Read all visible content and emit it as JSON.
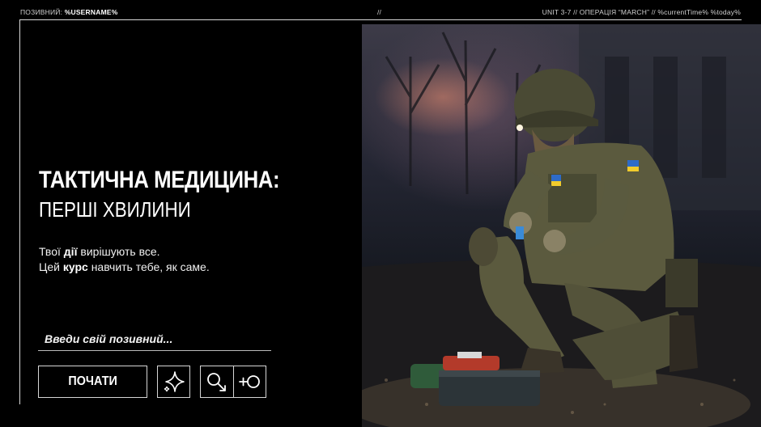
{
  "topbar": {
    "callsign_label": "ПОЗИВНИЙ:",
    "callsign_value": "%USERNAME%",
    "separator": "//",
    "status": "UNIT 3-7 // ОПЕРАЦІЯ “MARCH” // %currentTime% %today%"
  },
  "main": {
    "title_line1": "ТАКТИЧНА МЕДИЦИНА:",
    "title_line2": "ПЕРШІ ХВИЛИНИ",
    "desc_line1_a": "Твої ",
    "desc_line1_b": "дії",
    "desc_line1_c": " вирішують все.",
    "desc_line2_a": "Цей ",
    "desc_line2_b": "курс",
    "desc_line2_c": " навчить тебе, як саме."
  },
  "form": {
    "callsign_placeholder": "Введи свій позивний...",
    "start_label": "ПОЧАТИ"
  },
  "icons": {
    "sparkle": "sparkle-icon",
    "gender_male": "male-symbol-icon",
    "gender_female": "female-symbol-icon"
  },
  "colors": {
    "background": "#000000",
    "border": "#d6d6d6",
    "text": "#ffffff"
  }
}
